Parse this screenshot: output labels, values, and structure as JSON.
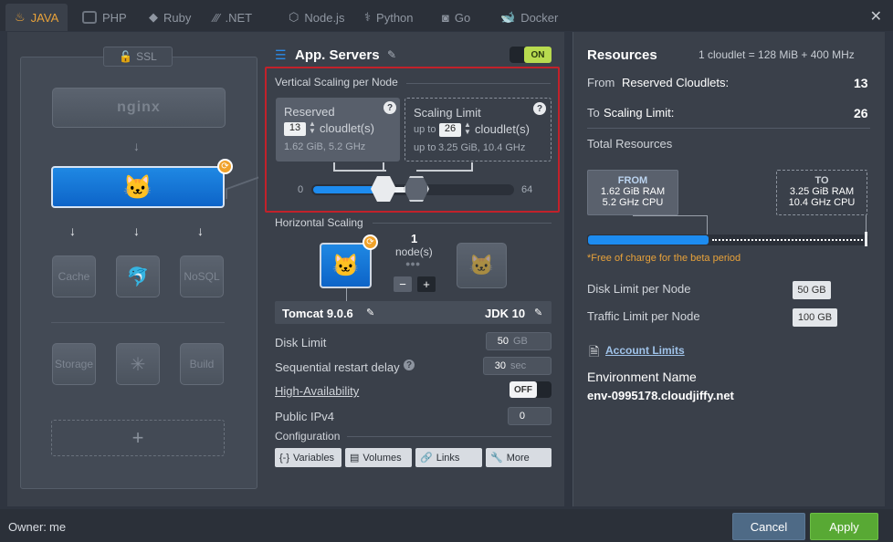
{
  "tabs": [
    {
      "label": "JAVA",
      "icon": "java-icon",
      "active": true
    },
    {
      "label": "PHP",
      "icon": "php-icon"
    },
    {
      "label": "Ruby",
      "icon": "ruby-icon"
    },
    {
      "label": ".NET",
      "icon": "dotnet-icon"
    },
    {
      "label": "Node.js",
      "icon": "nodejs-icon"
    },
    {
      "label": "Python",
      "icon": "python-icon"
    },
    {
      "label": "Go",
      "icon": "go-icon"
    },
    {
      "label": "Docker",
      "icon": "docker-icon"
    }
  ],
  "topology": {
    "ssl": "SSL",
    "balancer": "nginx",
    "nodes": [
      "Cache",
      "NoSQL"
    ],
    "bottom": [
      "Storage",
      "Build"
    ],
    "add": "+"
  },
  "app": {
    "title": "App. Servers",
    "toggle": "ON",
    "vertical_title": "Vertical Scaling per Node",
    "reserved_label": "Reserved",
    "reserved_value": "13",
    "cloudlets_label": "cloudlet(s)",
    "reserved_info": "1.62 GiB, 5.2 GHz",
    "limit_label": "Scaling Limit",
    "upto": "up to",
    "limit_value": "26",
    "limit_info_prefix": "up to",
    "limit_info": "3.25 GiB, 10.4 GHz",
    "slider_min": "0",
    "slider_max": "64",
    "horizontal_title": "Horizontal Scaling",
    "node_count": "1",
    "node_label": "node(s)",
    "minus": "−",
    "plus": "+",
    "server": "Tomcat 9.0.6",
    "jdk": "JDK 10",
    "disk_limit": "Disk Limit",
    "disk_value": "50",
    "disk_unit": "GB",
    "restart_delay": "Sequential restart delay",
    "restart_value": "30",
    "restart_unit": "sec",
    "ha": "High-Availability",
    "ha_toggle": "OFF",
    "ipv4": "Public IPv4",
    "ipv4_value": "0",
    "config": "Configuration",
    "config_buttons": [
      "Variables",
      "Volumes",
      "Links",
      "More"
    ]
  },
  "resources": {
    "title": "Resources",
    "note": "1 cloudlet = 128 MiB + 400 MHz",
    "from_prefix": "From",
    "from_label": "Reserved Cloudlets:",
    "from_value": "13",
    "to_prefix": "To",
    "to_label": "Scaling Limit:",
    "to_value": "26",
    "total": "Total Resources",
    "from_box": "FROM",
    "from_ram": "1.62 GiB RAM",
    "from_cpu": "5.2 GHz CPU",
    "to_box": "TO",
    "to_ram": "3.25 GiB RAM",
    "to_cpu": "10.4 GHz CPU",
    "free_note": "*Free of charge for the beta period",
    "disk": "Disk Limit per Node",
    "disk_val": "50 GB",
    "traffic": "Traffic Limit per Node",
    "traffic_val": "100 GB",
    "account": "Account Limits",
    "env_label": "Environment Name",
    "env_value": "env-0995178.cloudjiffy.net"
  },
  "footer": {
    "owner_label": "Owner:",
    "owner": "me",
    "cancel": "Cancel",
    "apply": "Apply"
  },
  "colors": {
    "accent": "#1d7fdc",
    "orange": "#e8a23a",
    "apply": "#58a934",
    "red": "#c2212a"
  }
}
